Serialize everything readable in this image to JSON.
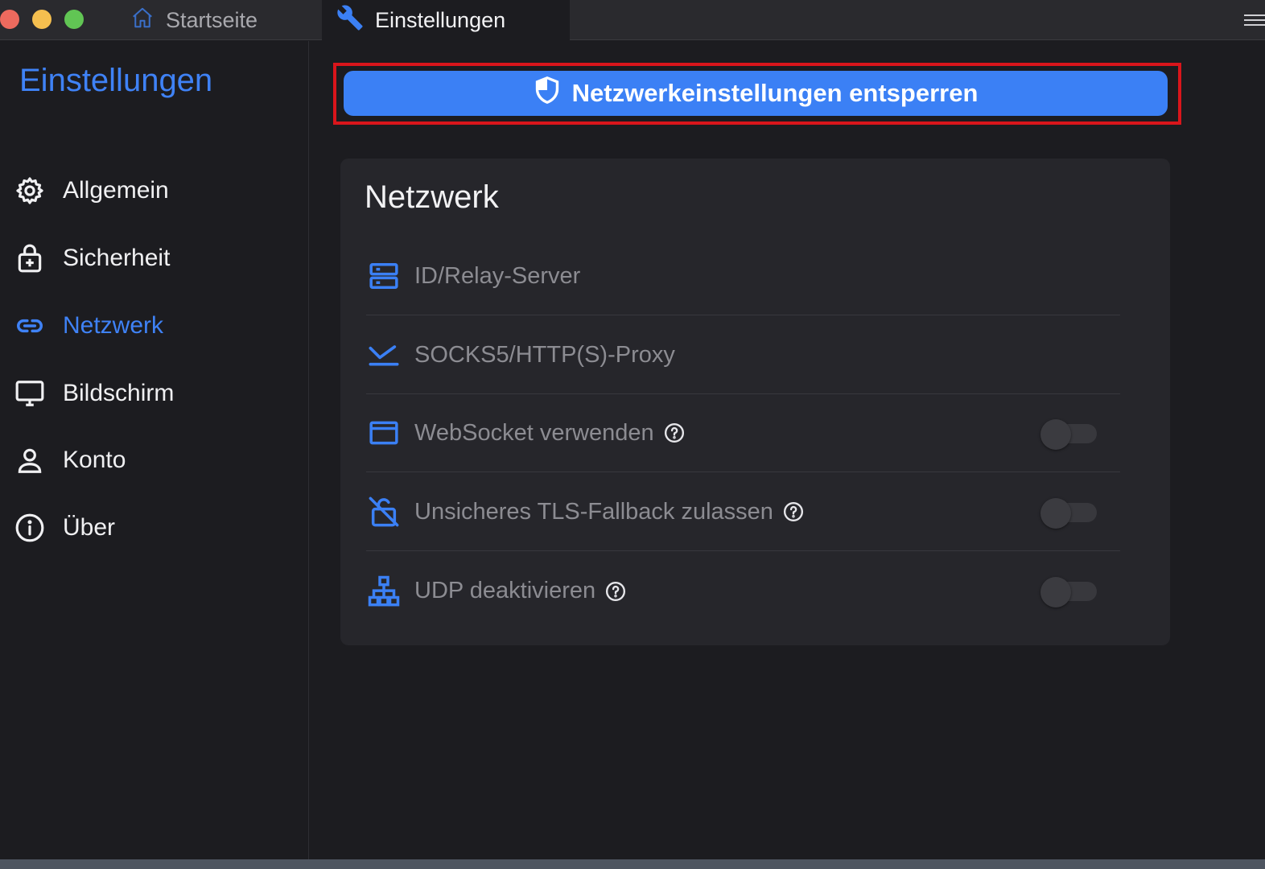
{
  "titlebar": {
    "tabs": [
      {
        "label": "Startseite",
        "icon": "home-icon",
        "active": false
      },
      {
        "label": "Einstellungen",
        "icon": "wrench-icon",
        "active": true
      }
    ],
    "menu_icon": "hamburger-menu-icon"
  },
  "sidebar": {
    "title": "Einstellungen",
    "items": [
      {
        "label": "Allgemein",
        "icon": "gear-icon",
        "active": false
      },
      {
        "label": "Sicherheit",
        "icon": "lock-plus-icon",
        "active": false
      },
      {
        "label": "Netzwerk",
        "icon": "link-icon",
        "active": true
      },
      {
        "label": "Bildschirm",
        "icon": "monitor-icon",
        "active": false
      },
      {
        "label": "Konto",
        "icon": "user-icon",
        "active": false
      },
      {
        "label": "Über",
        "icon": "info-icon",
        "active": false
      }
    ]
  },
  "main": {
    "unlock_button": {
      "label": "Netzwerkeinstellungen entsperren",
      "icon": "shield-icon"
    },
    "panel": {
      "title": "Netzwerk",
      "rows": [
        {
          "label": "ID/Relay-Server",
          "icon": "server-icon",
          "help": false,
          "toggle": null
        },
        {
          "label": "SOCKS5/HTTP(S)-Proxy",
          "icon": "proxy-icon",
          "help": false,
          "toggle": null
        },
        {
          "label": "WebSocket verwenden",
          "icon": "window-icon",
          "help": true,
          "toggle": false
        },
        {
          "label": "Unsicheres TLS-Fallback zulassen",
          "icon": "lock-off-icon",
          "help": true,
          "toggle": false
        },
        {
          "label": "UDP deaktivieren",
          "icon": "network-tree-icon",
          "help": true,
          "toggle": false
        }
      ]
    }
  },
  "colors": {
    "accent": "#3b80f5",
    "highlight_frame": "#d9151b",
    "background": "#1c1c20",
    "panel": "#26262b"
  }
}
